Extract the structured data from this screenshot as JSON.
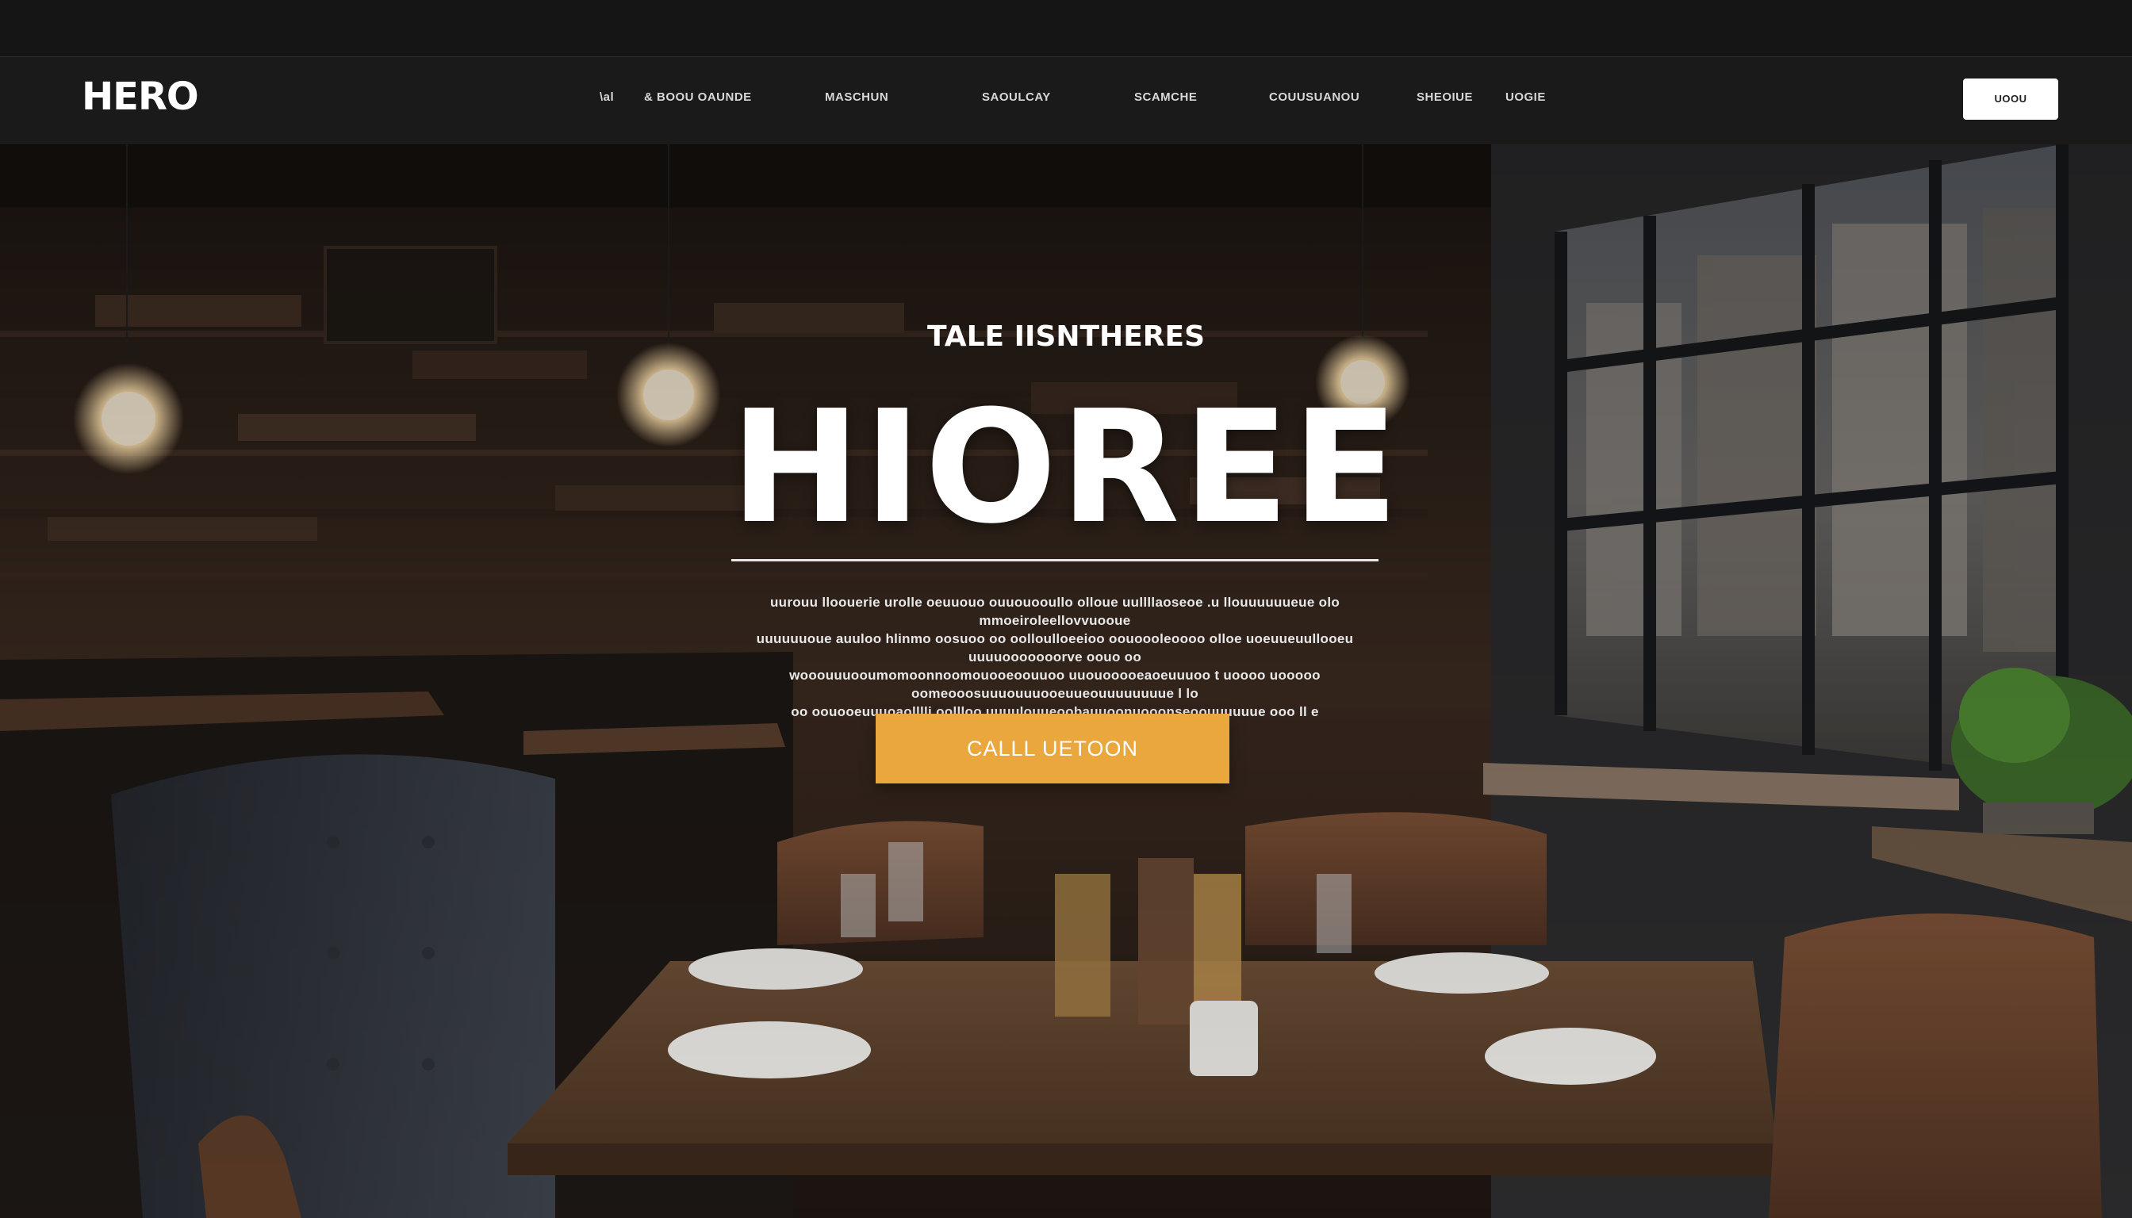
{
  "nav": {
    "logo": "HERO",
    "links": [
      "\\al",
      "& BOOU OAUNDE",
      "MASCHUN",
      "SAOULCAY",
      "SCAMCHE",
      "COUUSUANOU",
      "SHEOIUE",
      "UOGIE"
    ],
    "cta_label": "UOOU"
  },
  "hero": {
    "eyebrow": "TALE IISNTHERES",
    "title": "HIOREE",
    "copy_lines": [
      "uurouu lloouerie urolle oeuuouo ouuouooullo olloue uullllaoseoe .u llouuuuuueue olo mmoeiroleellovvuooue",
      "uuuuuuoue auuloo hlinmo oosuoo oo oolloulloeeioo oouoooleoooo olloe uoeuueuullooeu uuuuooooooorve oouo oo",
      "wooouuuooumomoonnoomouooeoouuoo uuouooooeaoeuuuoo t uoooo uooooo oomeooosuuuouuuooeuueouuuuuuuue l lo",
      "oo oouooeuuuoaolllli oollloo uuuulouueoobauuoonuooonseoouuuuuue ooo ll e"
    ],
    "button_label": "CALLL UETOON"
  },
  "colors": {
    "accent": "#e9a73e",
    "nav_bg": "#1a1a1a",
    "top_strip": "#151515"
  }
}
